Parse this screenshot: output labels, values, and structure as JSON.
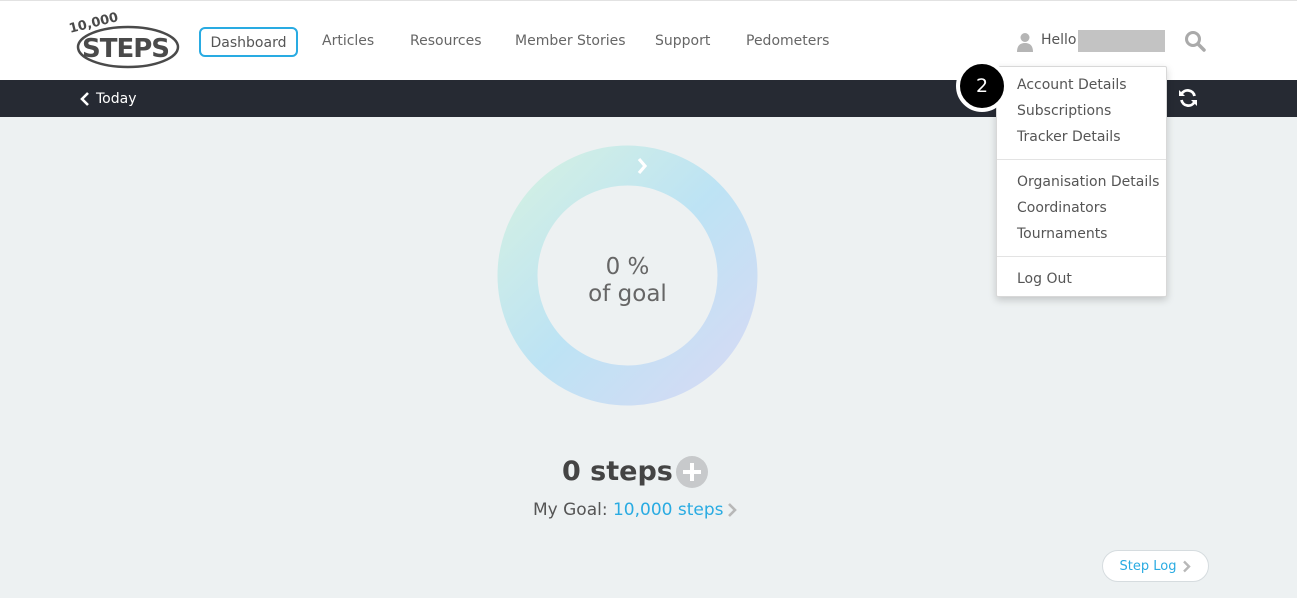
{
  "brand": {
    "logo_top": "10,000",
    "logo_main": "STEPS"
  },
  "nav": {
    "items": [
      {
        "label": "Dashboard",
        "active": true
      },
      {
        "label": "Articles"
      },
      {
        "label": "Resources"
      },
      {
        "label": "Member Stories"
      },
      {
        "label": "Support"
      },
      {
        "label": "Pedometers"
      }
    ],
    "hello": "Hello"
  },
  "subbar": {
    "back_label": "Today"
  },
  "dropdown": {
    "badge": "2",
    "groups": [
      [
        "Account Details",
        "Subscriptions",
        "Tracker Details"
      ],
      [
        "Organisation Details",
        "Coordinators",
        "Tournaments"
      ],
      [
        "Log Out"
      ]
    ]
  },
  "progress": {
    "percent_text": "0 %",
    "of_goal": "of goal",
    "fraction": 0
  },
  "steps": {
    "count_text": "0 steps",
    "goal_label": "My Goal:",
    "goal_value": "10,000 steps"
  },
  "step_log": {
    "label": "Step Log"
  },
  "colors": {
    "accent": "#29abe2",
    "subbar": "#262a33",
    "background": "#edf1f2"
  }
}
